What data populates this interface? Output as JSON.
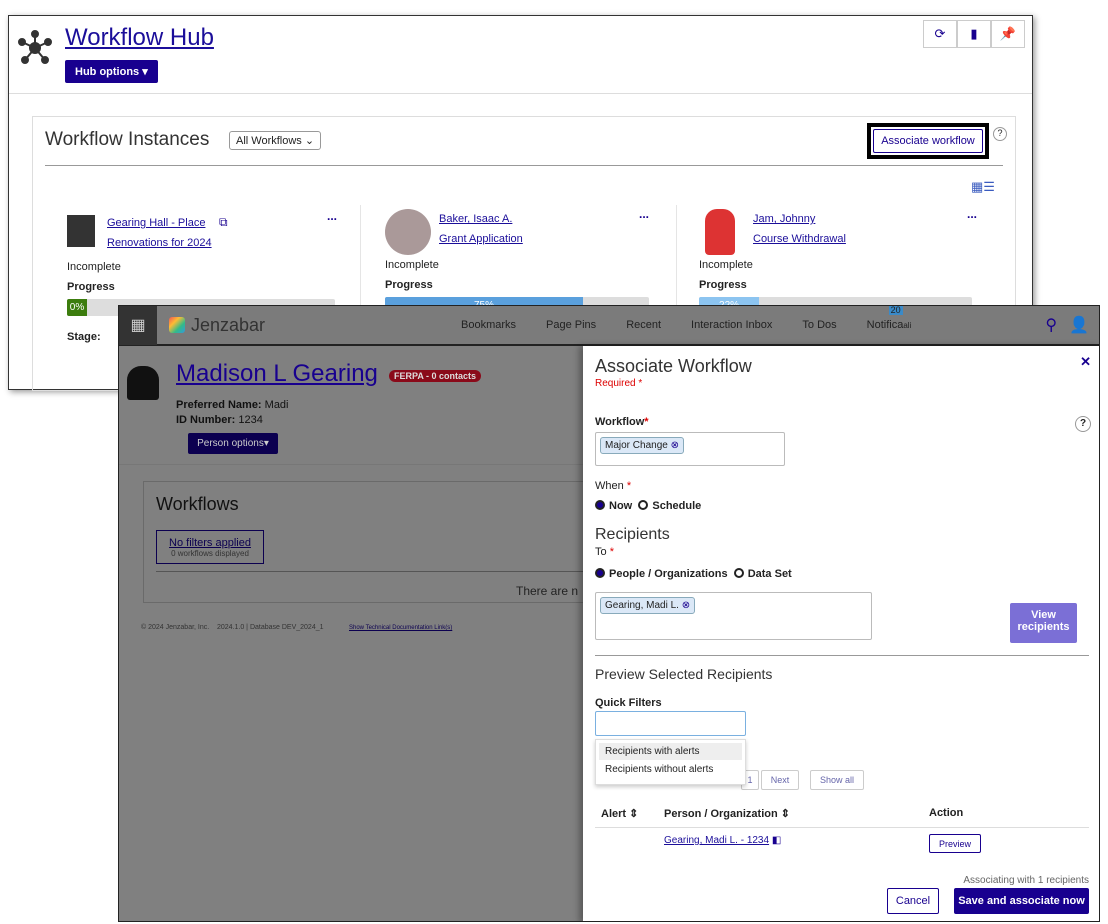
{
  "hub": {
    "title": "Workflow Hub",
    "options": "Hub options",
    "toolbar": [
      "sync-icon",
      "bookmark-icon",
      "pin-icon"
    ],
    "instances_title": "Workflow Instances",
    "filter": "All Workflows",
    "associate": "Associate workflow",
    "help": "?",
    "cards": [
      {
        "link1": "Gearing Hall - Place",
        "link2": "Renovations for 2024",
        "status": "Incomplete",
        "progress_label": "Progress",
        "progress": 0,
        "progress_text": "0%",
        "stage": "Stage:",
        "more": "..."
      },
      {
        "link1": "Baker, Isaac A.",
        "link2": "Grant Application",
        "status": "Incomplete",
        "progress_label": "Progress",
        "progress": 75,
        "progress_text": "75%",
        "more": "..."
      },
      {
        "link1": "Jam, Johnny",
        "link2": "Course Withdrawal",
        "status": "Incomplete",
        "progress_label": "Progress",
        "progress": 22,
        "progress_text": "22%",
        "more": "..."
      }
    ]
  },
  "nav": {
    "brand": "Jenzabar",
    "items": [
      "Bookmarks",
      "Page Pins",
      "Recent",
      "Interaction Inbox",
      "To Dos",
      "Notifica"
    ],
    "notif_badge": "20",
    "notif_suffix": "ali"
  },
  "person": {
    "name": "Madison L Gearing",
    "ferpa": "FERPA - 0 contacts",
    "pref_label": "Preferred Name:",
    "pref": "Madi",
    "id_label": "ID Number:",
    "id": "1234",
    "options": "Person options",
    "workflows_title": "Workflows",
    "filter_link": "No filters applied",
    "filter_sub": "0 workflows displayed",
    "empty": "There are n",
    "footer": "© 2024 Jenzabar, Inc.    2024.1.0 | Database DEV_2024_1",
    "footer_link": "Show Technical Documentation Link(s)"
  },
  "panel": {
    "title": "Associate Workflow",
    "required": "Required",
    "workflow_label": "Workflow",
    "workflow_tag": "Major Change",
    "when_label": "When",
    "now": "Now",
    "schedule": "Schedule",
    "recipients_title": "Recipients",
    "to_label": "To",
    "people": "People / Organizations",
    "dataset": "Data Set",
    "recipient_tag": "Gearing, Madi L.",
    "view": "View recipients",
    "preview_title": "Preview Selected Recipients",
    "quick_filters": "Quick Filters",
    "qf_value": "",
    "qf_options": [
      "Recipients with alerts",
      "Recipients without alerts"
    ],
    "page": "1",
    "next": "Next",
    "show_all": "Show all",
    "columns": [
      "Alert",
      "Person / Organization",
      "Action"
    ],
    "rows": [
      {
        "person": "Gearing, Madi L. - 1234",
        "action": "Preview"
      }
    ],
    "assoc_count": "Associating with 1 recipients",
    "cancel": "Cancel",
    "save": "Save and associate now"
  },
  "colors": {
    "navy": "#18008f",
    "ferpa": "#c8102e",
    "progress": "#5aa0dd",
    "zero": "#3c7d0e"
  }
}
